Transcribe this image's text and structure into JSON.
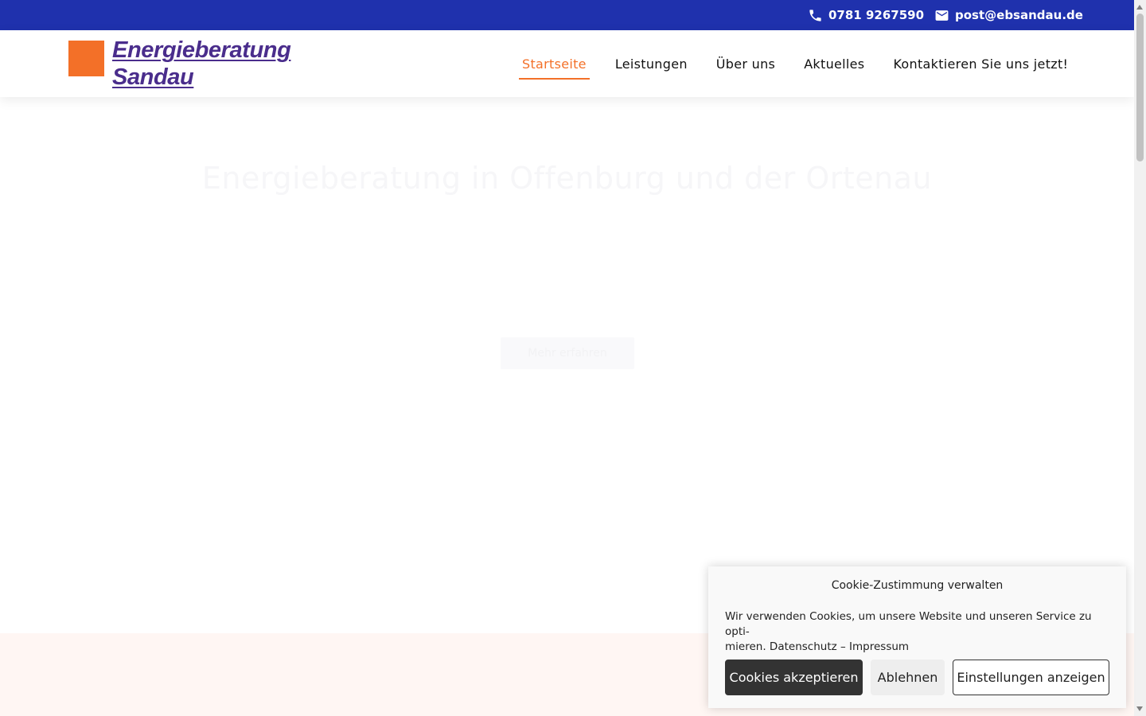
{
  "topbar": {
    "phone": "0781 9267590",
    "email": "post@ebsandau.de",
    "phone_icon": "phone-icon",
    "mail_icon": "mail-icon",
    "background": "#1f31ad"
  },
  "header": {
    "logo_line1": "Energieberatung",
    "logo_line2": "Sandau",
    "nav": [
      {
        "label": "Startseite",
        "active": true
      },
      {
        "label": "Leistungen",
        "active": false
      },
      {
        "label": "Über uns",
        "active": false
      },
      {
        "label": "Aktuelles",
        "active": false
      },
      {
        "label": "Kontaktieren Sie uns jetzt!",
        "active": false
      }
    ]
  },
  "hero": {
    "title": "Energieberatung in Offenburg und der Ortenau",
    "button_label": "Mehr erfahren"
  },
  "cookie": {
    "title": "Cookie-Zustimmung verwalten",
    "text_line1": "Wir verwenden Cookies, um unsere Website und unseren Service zu opti-",
    "text_line2": "mieren.",
    "link_privacy": "Datenschutz",
    "separator": "–",
    "link_imprint": "Impressum",
    "accept_label": "Cookies akzeptieren",
    "deny_label": "Ablehnen",
    "prefs_label": "Einstellungen anzeigen"
  },
  "colors": {
    "accent": "#f37028",
    "brand_blue": "#1f31ad",
    "logo_purple": "#4a2d8c"
  }
}
